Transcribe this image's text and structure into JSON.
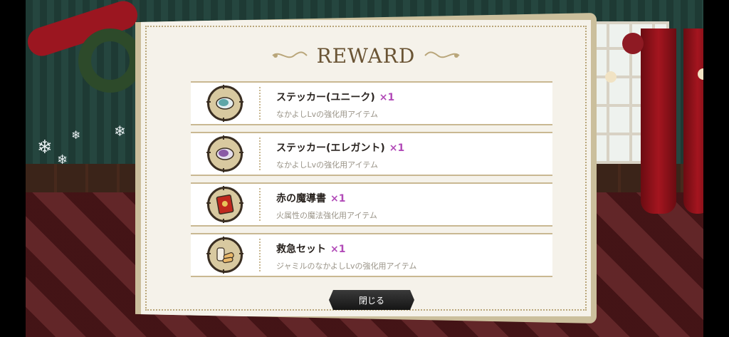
{
  "dialog": {
    "title": "REWARD",
    "close_label": "閉じる"
  },
  "rewards": [
    {
      "name": "ステッカー(ユニーク)",
      "qty": "×1",
      "desc": "なかよしLvの強化用アイテム",
      "icon": "sticker-unique-icon",
      "color": "#5fa6a8"
    },
    {
      "name": "ステッカー(エレガント)",
      "qty": "×1",
      "desc": "なかよしLvの強化用アイテム",
      "icon": "sticker-elegant-icon",
      "color": "#8a5aa6"
    },
    {
      "name": "赤の魔導書",
      "qty": "×1",
      "desc": "火属性の魔法強化用アイテム",
      "icon": "red-grimoire-icon",
      "color": "#c0281e"
    },
    {
      "name": "救急セット",
      "qty": "×1",
      "desc": "ジャミルのなかよしLvの強化用アイテム",
      "icon": "first-aid-kit-icon",
      "color": "#e8d3a8"
    }
  ]
}
